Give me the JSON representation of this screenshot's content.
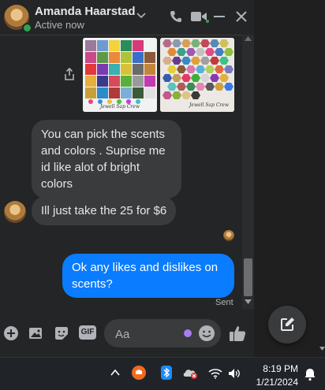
{
  "header": {
    "name": "Amanda Haarstad",
    "status": "Active now"
  },
  "messages": {
    "m1": "You can pick the scents and colors . Suprise me id like alot of bright colors",
    "m2": "Ill just take the 25 for $6",
    "m3": "Ok any likes and dislikes on scents?",
    "sent_label": "Sent"
  },
  "images": {
    "watermark1": "Jewell Sap Crew",
    "watermark2": "Jewell Sap Crew"
  },
  "composer": {
    "placeholder": "Aa",
    "gif_label": "GIF"
  },
  "taskbar": {
    "time": "8:19 PM",
    "date": "1/21/2024"
  },
  "colors": {
    "accent": "#0a7cff",
    "panel": "#242526",
    "bubble_in": "#3a3b3c",
    "online": "#31a24c"
  }
}
